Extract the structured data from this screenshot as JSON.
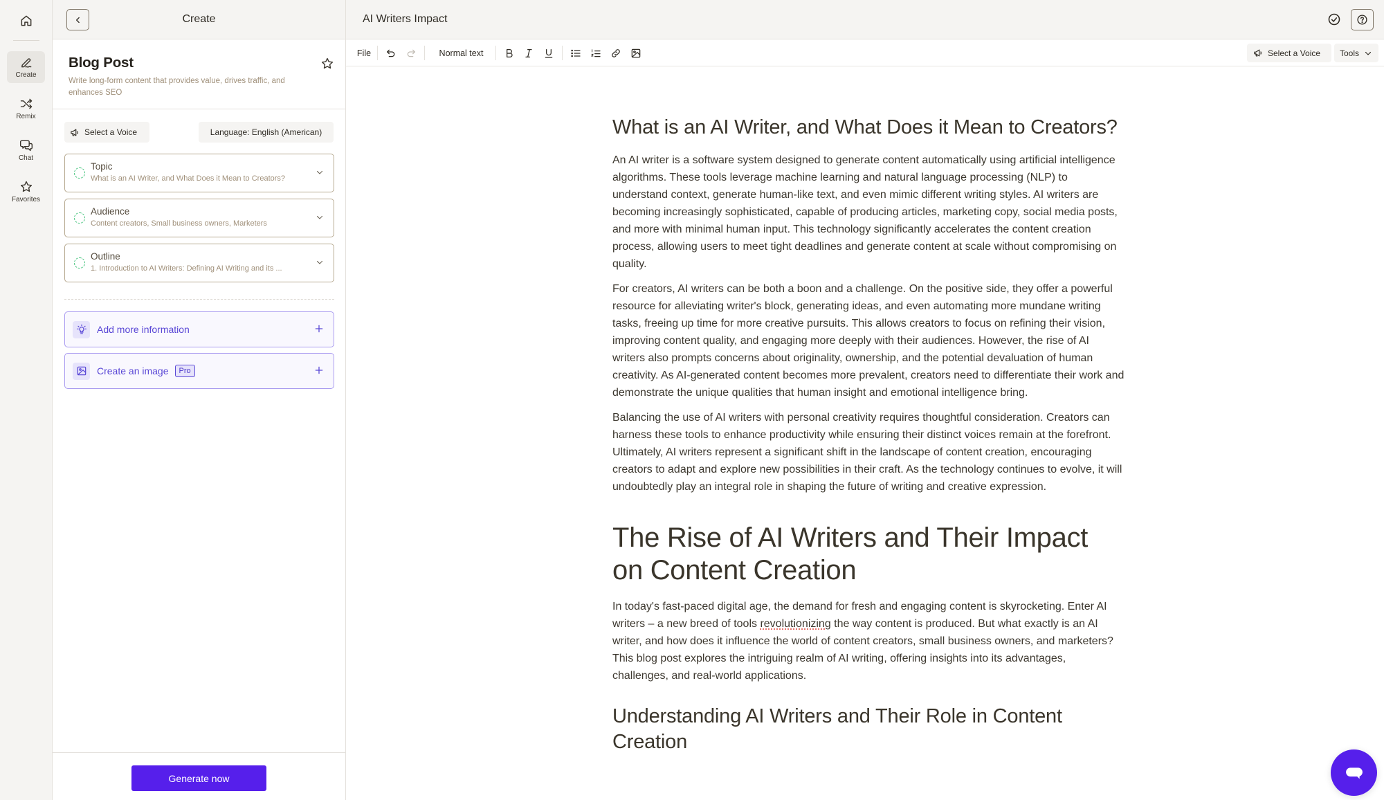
{
  "rail": {
    "home_icon": "home-icon",
    "items": [
      {
        "label": "Create",
        "icon": "pen-icon",
        "active": true
      },
      {
        "label": "Remix",
        "icon": "shuffle-icon",
        "active": false
      },
      {
        "label": "Chat",
        "icon": "chat-bubbles-icon",
        "active": false
      },
      {
        "label": "Favorites",
        "icon": "star-icon",
        "active": false
      }
    ]
  },
  "panel": {
    "header_title": "Create",
    "template": {
      "title": "Blog Post",
      "description": "Write long-form content that provides value, drives traffic, and enhances SEO"
    },
    "voice_button": "Select a Voice",
    "language_button": "Language: English (American)",
    "fields": [
      {
        "label": "Topic",
        "value": "What is an AI Writer, and What Does it Mean to Creators?"
      },
      {
        "label": "Audience",
        "value": "Content creators, Small business owners, Marketers"
      },
      {
        "label": "Outline",
        "value": "1. Introduction to AI Writers: Defining AI Writing and its ..."
      }
    ],
    "actions": [
      {
        "label": "Add more information",
        "icon": "lightbulb-icon"
      },
      {
        "label": "Create an image",
        "icon": "image-icon",
        "badge": "Pro"
      }
    ],
    "generate_button": "Generate now"
  },
  "editor": {
    "doc_title": "AI Writers Impact",
    "toolbar": {
      "file": "File",
      "style": "Normal text",
      "voice_button": "Select a Voice",
      "tools_button": "Tools"
    },
    "content": {
      "h2_1": "What is an AI Writer, and What Does it Mean to Creators?",
      "p1": "An AI writer is a software system designed to generate content automatically using artificial intelligence algorithms. These tools leverage machine learning and natural language processing (NLP) to understand context, generate human-like text, and even mimic different writing styles. AI writers are becoming increasingly sophisticated, capable of producing articles, marketing copy, social media posts, and more with minimal human input. This technology significantly accelerates the content creation process, allowing users to meet tight deadlines and generate content at scale without compromising on quality.",
      "p2": "For creators, AI writers can be both a boon and a challenge. On the positive side, they offer a powerful resource for alleviating writer's block, generating ideas, and even automating more mundane writing tasks, freeing up time for more creative pursuits. This allows creators to focus on refining their vision, improving content quality, and engaging more deeply with their audiences. However, the rise of AI writers also prompts concerns about originality, ownership, and the potential devaluation of human creativity. As AI-generated content becomes more prevalent, creators need to differentiate their work and demonstrate the unique qualities that human insight and emotional intelligence bring.",
      "p3": "Balancing the use of AI writers with personal creativity requires thoughtful consideration. Creators can harness these tools to enhance productivity while ensuring their distinct voices remain at the forefront. Ultimately, AI writers represent a significant shift in the landscape of content creation, encouraging creators to adapt and explore new possibilities in their craft. As the technology continues to evolve, it will undoubtedly play an integral role in shaping the future of writing and creative expression.",
      "h1": "The Rise of AI Writers and Their Impact on Content Creation",
      "p4_a": "In today's fast-paced digital age, the demand for fresh and engaging content is skyrocketing. Enter AI writers – a new breed of tools ",
      "p4_misspelled": "revolutionizing",
      "p4_b": " the way content is produced. But what exactly is an AI writer, and how does it influence the world of content creators, small business owners, and marketers? This blog post explores the intriguing realm of AI writing, offering insights into its advantages, challenges, and real-world applications.",
      "h2_2": "Understanding AI Writers and Their Role in Content Creation"
    }
  },
  "colors": {
    "accent": "#561feb",
    "accent_text": "#5a48d6",
    "field_border": "#b6a990",
    "status_dot": "#42c27a",
    "chrome_bg": "#f5f4f2"
  }
}
